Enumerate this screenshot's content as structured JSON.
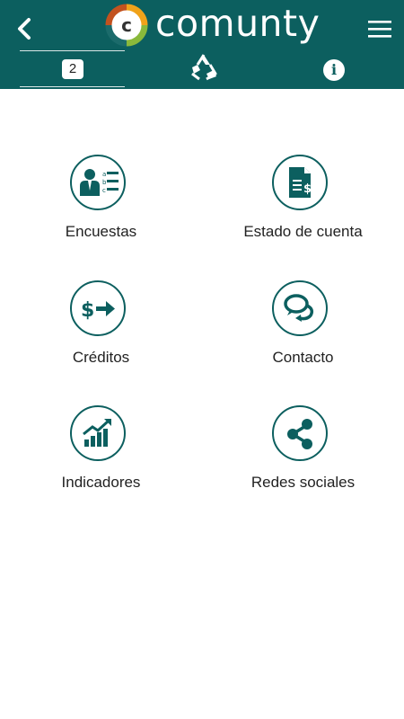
{
  "header": {
    "logo_text": "comunty",
    "badge_count": "2",
    "info_label": "i"
  },
  "menu": {
    "items": [
      {
        "label": "Encuestas",
        "icon": "survey-icon"
      },
      {
        "label": "Estado de cuenta",
        "icon": "account-statement-icon"
      },
      {
        "label": "Créditos",
        "icon": "credit-icon"
      },
      {
        "label": "Contacto",
        "icon": "contact-icon"
      },
      {
        "label": "Indicadores",
        "icon": "indicators-icon"
      },
      {
        "label": "Redes sociales",
        "icon": "share-icon"
      }
    ]
  },
  "colors": {
    "brand": "#0c5f5f",
    "background": "#ffffff",
    "text": "#222222"
  }
}
